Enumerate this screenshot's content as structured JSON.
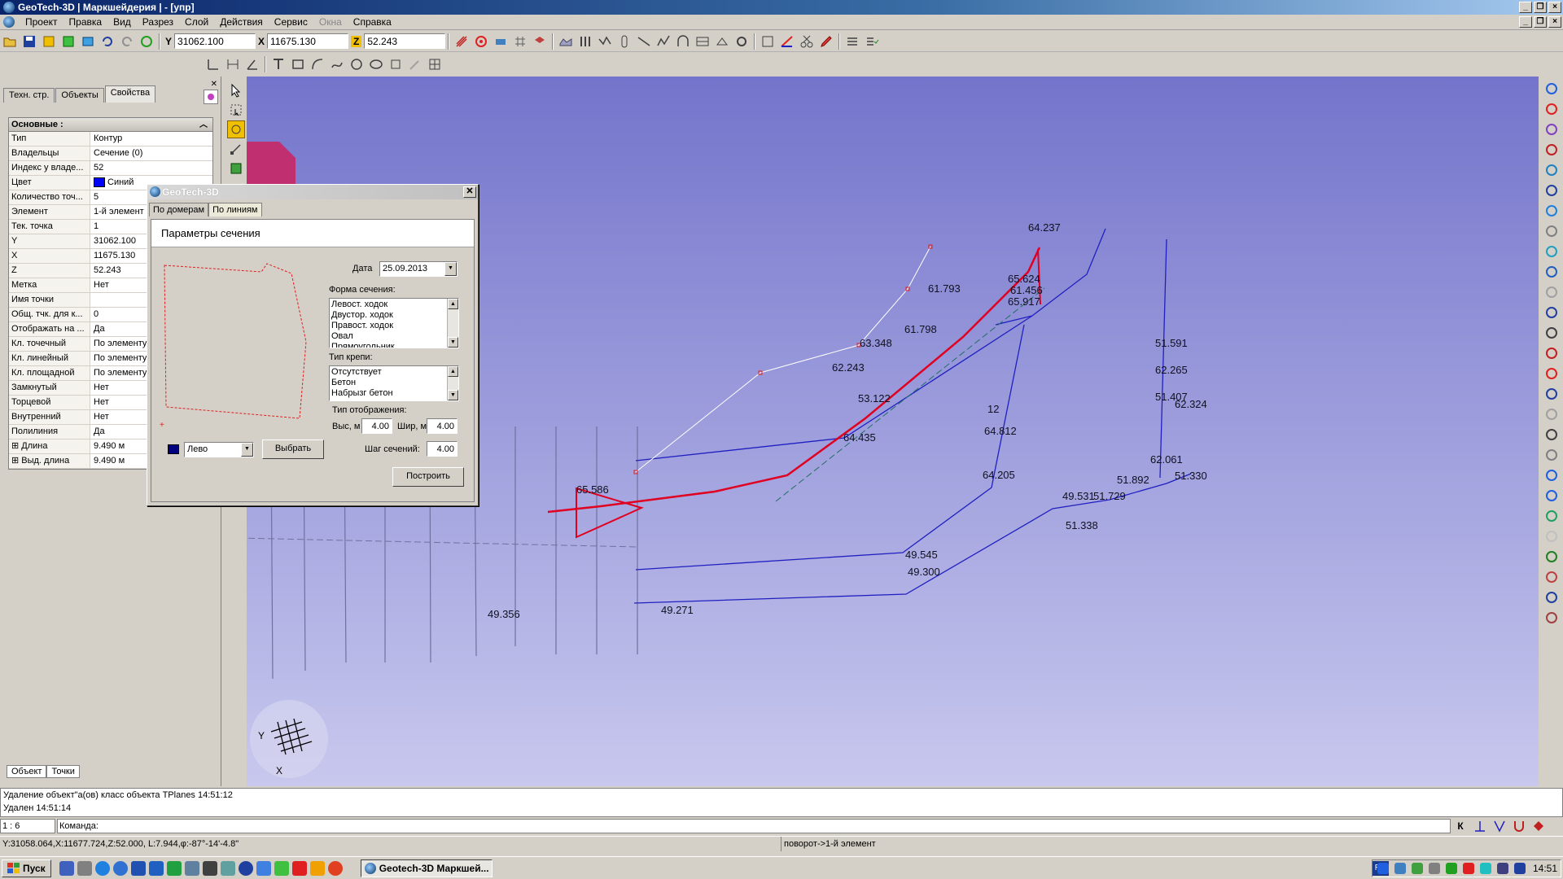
{
  "window": {
    "title": "GeoTech-3D | Маркшейдерия | - [упр]"
  },
  "menu": {
    "items": [
      "Проект",
      "Правка",
      "Вид",
      "Разрез",
      "Слой",
      "Действия",
      "Сервис",
      "Окна",
      "Справка"
    ]
  },
  "coords": {
    "y_label": "Y",
    "y_value": "31062.100",
    "x_label": "X",
    "x_value": "11675.130",
    "z_label": "Z",
    "z_value": "52.243"
  },
  "left_panel": {
    "tabs": [
      "Техн. стр.",
      "Объекты",
      "Свойства"
    ],
    "active_tab": "Свойства",
    "section_title": "Основные :",
    "rows": [
      {
        "name": "Тип",
        "value": "Контур"
      },
      {
        "name": "Владельцы",
        "value": "Сечение (0)"
      },
      {
        "name": "Индекс у владе...",
        "value": "52"
      },
      {
        "name": "Цвет",
        "value": "Синий"
      },
      {
        "name": "Количество точ...",
        "value": "5"
      },
      {
        "name": "Элемент",
        "value": "1-й элемент"
      },
      {
        "name": "Тек. точка",
        "value": "1"
      },
      {
        "name": "  Y",
        "value": "31062.100"
      },
      {
        "name": "  X",
        "value": "11675.130"
      },
      {
        "name": "  Z",
        "value": "52.243"
      },
      {
        "name": "  Метка",
        "value": "Нет"
      },
      {
        "name": "  Имя точки",
        "value": ""
      },
      {
        "name": "  Общ. тчк. для к...",
        "value": "0"
      },
      {
        "name": "Отображать на ...",
        "value": "Да"
      },
      {
        "name": "Кл. точечный",
        "value": "По элементу"
      },
      {
        "name": "Кл. линейный",
        "value": "По элементу"
      },
      {
        "name": "Кл. площадной",
        "value": "По элементу"
      },
      {
        "name": "Замкнутый",
        "value": "Нет"
      },
      {
        "name": "Торцевой",
        "value": "Нет"
      },
      {
        "name": "Внутренний",
        "value": "Нет"
      },
      {
        "name": "Полилиния",
        "value": "Да"
      },
      {
        "name": "⊞ Длина",
        "value": "9.490 м"
      },
      {
        "name": "⊞ Выд. длина",
        "value": "9.490 м"
      }
    ],
    "color_swatch": "#0000ff",
    "bottom_tabs": [
      "Объект",
      "Точки"
    ]
  },
  "dialog": {
    "title": "GeoTech-3D",
    "tabs": [
      "По домерам",
      "По линиям"
    ],
    "active_tab": "По линиям",
    "header": "Параметры сечения",
    "date_label": "Дата",
    "date_value": "25.09.2013",
    "shape_label": "Форма сечения:",
    "shape_options": [
      "Левост. ходок",
      "Двустор. ходок",
      "Правост. ходок",
      "Овал",
      "Прямоугольник"
    ],
    "support_label": "Тип крепи:",
    "support_options": [
      "Отсутствует",
      "Бетон",
      "Набрызг бетон"
    ],
    "display_label": "Тип отображения:",
    "height_label": "Выс, м",
    "height_value": "4.00",
    "width_label": "Шир, м",
    "width_value": "4.00",
    "step_label": "Шаг сечений:",
    "step_value": "4.00",
    "side_value": "Лево",
    "choose_button": "Выбрать",
    "build_button": "Построить"
  },
  "viewport": {
    "labels": [
      {
        "text": "64.237"
      },
      {
        "text": "65.624"
      },
      {
        "text": "61.456"
      },
      {
        "text": "65.917"
      },
      {
        "text": "61.793"
      },
      {
        "text": "61.798"
      },
      {
        "text": "63.348"
      },
      {
        "text": "62.243"
      },
      {
        "text": "53.122"
      },
      {
        "text": "64.435"
      },
      {
        "text": "12"
      },
      {
        "text": "64.812"
      },
      {
        "text": "64.205"
      },
      {
        "text": "51.591"
      },
      {
        "text": "62.265"
      },
      {
        "text": "51.407"
      },
      {
        "text": "62.324"
      },
      {
        "text": "62.061"
      },
      {
        "text": "51.330"
      },
      {
        "text": "51.892"
      },
      {
        "text": "49.531"
      },
      {
        "text": "51.729"
      },
      {
        "text": "51.338"
      },
      {
        "text": "49.545"
      },
      {
        "text": "49.300"
      },
      {
        "text": "49.271"
      },
      {
        "text": "49.356"
      },
      {
        "text": "65.586"
      }
    ],
    "axis_y": "Y",
    "axis_x": "X"
  },
  "output": {
    "line1": "Удаление объект\"а(ов) класс объекта TPlanes 14:51:12",
    "line2": "Удален 14:51:14"
  },
  "command": {
    "scale": "1 : 6",
    "label": "Команда:"
  },
  "status": {
    "coords": "Y:31058.064,X:11677.724,Z:52.000, L:7.944,φ:-87°-14'-4.8\"",
    "hint": "поворот->1-й элемент"
  },
  "taskbar": {
    "start": "Пуск",
    "window": "Geotech-3D Маркшей...",
    "lang": "RU",
    "time": "14:51"
  },
  "colors": {
    "title_bar": "#0a246a",
    "viewport_top": "#7474cc",
    "viewport_bottom": "#c8c8ee",
    "blue_line": "#2020c0",
    "red_line": "#e00020"
  }
}
